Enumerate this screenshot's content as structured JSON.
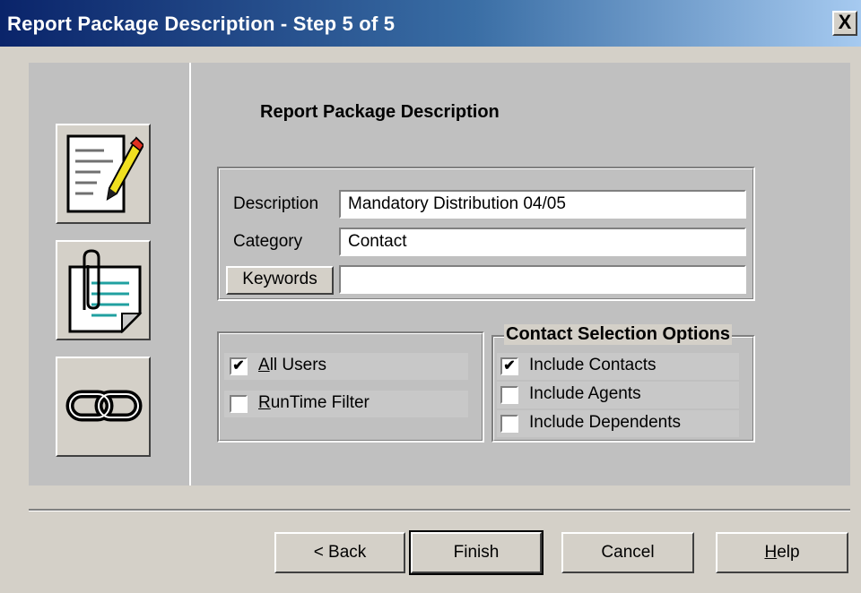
{
  "window": {
    "title": "Report Package Description - Step 5 of 5",
    "close_label": "X"
  },
  "sidebar": {
    "icons": [
      "document-edit-icon",
      "attachment-icon",
      "link-icon"
    ]
  },
  "main": {
    "heading": "Report Package Description",
    "description_label": "Description",
    "description_value": "Mandatory Distribution 04/05",
    "category_label": "Category",
    "category_value": "Contact",
    "keywords_label": "Keywords",
    "keywords_value": ""
  },
  "users_group": {
    "all_users_label": "All Users",
    "all_users_checked": true,
    "runtime_filter_label": "RunTime Filter",
    "runtime_filter_checked": false
  },
  "contact_group": {
    "title": "Contact Selection Options",
    "include_contacts_label": "Include Contacts",
    "include_contacts_checked": true,
    "include_agents_label": "Include Agents",
    "include_agents_checked": false,
    "include_dependents_label": "Include Dependents",
    "include_dependents_checked": false
  },
  "buttons": {
    "back": "< Back",
    "finish": "Finish",
    "cancel": "Cancel",
    "help": "Help"
  },
  "colors": {
    "title_gradient_start": "#0a246a",
    "title_gradient_end": "#a6caf0",
    "dialog_bg": "#d4d0c8",
    "panel_bg": "#c0c0c0"
  }
}
